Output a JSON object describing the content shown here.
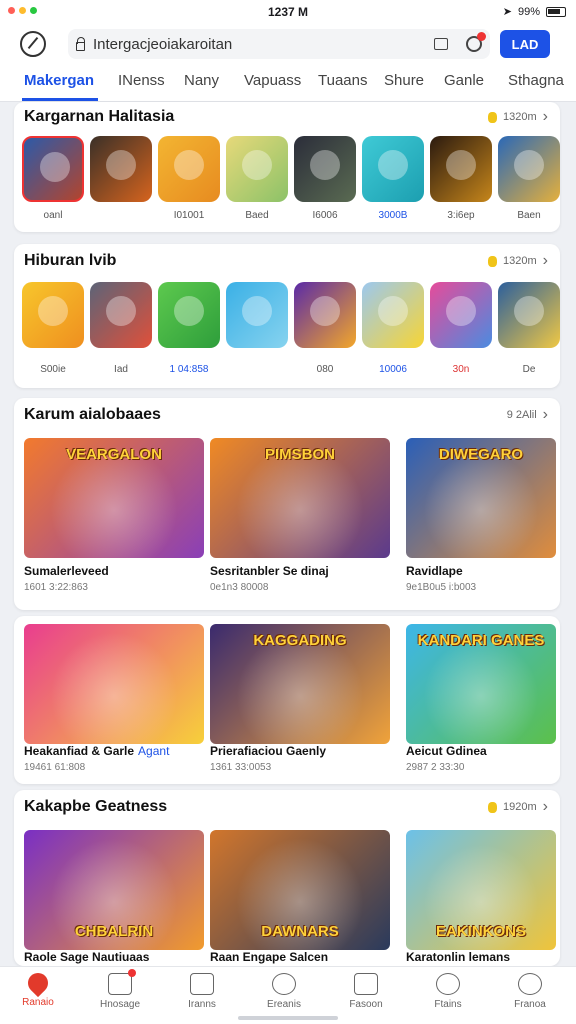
{
  "status": {
    "time": "1237 M",
    "battery": "99%"
  },
  "browser": {
    "address": "Intergacjeoiakaroitan",
    "login_label": "LAD"
  },
  "tabs": [
    "Makergan",
    "INenss",
    "Nany",
    "Vapuass",
    "Tuaans",
    "Shure",
    "Ganle",
    "Sthagna"
  ],
  "sections": [
    {
      "title": "Kargarnan Halitasia",
      "meta": "1320m",
      "apps": [
        {
          "label": "oanl",
          "c1": "#2d5aa8",
          "c2": "#b2452e",
          "label_color": "grey"
        },
        {
          "label": "",
          "c1": "#3a3028",
          "c2": "#d6641e",
          "label_color": "grey"
        },
        {
          "label": "I01001",
          "c1": "#f3b532",
          "c2": "#e78b20",
          "label_color": "grey"
        },
        {
          "label": "Baed",
          "c1": "#e7d97a",
          "c2": "#8cc268",
          "label_color": "grey"
        },
        {
          "label": "I6006",
          "c1": "#2b2d3a",
          "c2": "#5a6b52",
          "label_color": "grey"
        },
        {
          "label": "3000B",
          "c1": "#3fcad6",
          "c2": "#1c9fb0",
          "label_color": "blue"
        },
        {
          "label": "3:i6ep",
          "c1": "#2b1a0f",
          "c2": "#c6861b",
          "label_color": "grey"
        },
        {
          "label": "Baen",
          "c1": "#2a68b7",
          "c2": "#e5b03c",
          "label_color": "grey"
        }
      ]
    },
    {
      "title": "Hiburan lvib",
      "meta": "1320m",
      "apps": [
        {
          "label": "S00ie",
          "c1": "#f7c62c",
          "c2": "#ef8f1f",
          "label_color": "grey"
        },
        {
          "label": "Iad",
          "c1": "#5c6478",
          "c2": "#e0503a",
          "label_color": "grey"
        },
        {
          "label": "1 04:858",
          "c1": "#5dc94e",
          "c2": "#2e9e3b",
          "label_color": "blue"
        },
        {
          "label": "",
          "c1": "#3ab0e6",
          "c2": "#87d3ef",
          "label_color": "grey"
        },
        {
          "label": "080",
          "c1": "#5a2aa7",
          "c2": "#f3a72a",
          "label_color": "grey"
        },
        {
          "label": "10006",
          "c1": "#9cc8ef",
          "c2": "#f7d534",
          "label_color": "blue"
        },
        {
          "label": "30n",
          "c1": "#e64b9a",
          "c2": "#4b8be0",
          "label_color": "red"
        },
        {
          "label": "De",
          "c1": "#2c5f9c",
          "c2": "#f0c844",
          "label_color": "grey"
        }
      ]
    }
  ],
  "grid1": {
    "title": "Karum aialobaaes",
    "meta": "9 2Alil",
    "items": [
      {
        "title": "Sumalerleveed",
        "sub": "1601 3:22:863",
        "tag": "",
        "c1": "#f27a2d",
        "c2": "#8a3fb7",
        "banner": "VEARGALON"
      },
      {
        "title": "Sesritanbler Se dinaj",
        "sub": "0e1n3 80008",
        "tag": "",
        "c1": "#f08a24",
        "c2": "#5b3a8c",
        "banner": "PIMSBON"
      },
      {
        "title": "Ravidlape",
        "sub": "9e1B0u5 i:b003",
        "tag": "",
        "c1": "#2a5fb8",
        "c2": "#e08d3c",
        "banner": "DIWEGARO"
      }
    ]
  },
  "grid2": {
    "items": [
      {
        "title": "Heakanfiad & Garle",
        "tag": "Agant",
        "sub": "19461 61:808",
        "c1": "#e93d8f",
        "c2": "#f7d03a",
        "banner": ""
      },
      {
        "title": "Prierafiaciou Gaenly",
        "tag": "",
        "sub": "1361 33:0053",
        "c1": "#3a2a6e",
        "c2": "#f0a33a",
        "banner": "KAGGADING"
      },
      {
        "title": "Aeicut Gdinea",
        "tag": "",
        "sub": "2987 2 33:30",
        "c1": "#3db6e8",
        "c2": "#5cc04a",
        "banner": "KANDARI GANES"
      }
    ]
  },
  "grid3": {
    "title": "Kakapbe Geatness",
    "meta": "1920m",
    "items": [
      {
        "title": "Raole Sage Nautiuaas",
        "sub": "",
        "c1": "#7a2fc4",
        "c2": "#f19b2d",
        "banner": "CHBALRIN"
      },
      {
        "title": "Raan Engape Salcen",
        "sub": "",
        "c1": "#d1762c",
        "c2": "#2a3a5c",
        "banner": "DAWNARS"
      },
      {
        "title": "Karatonlin lemans",
        "sub": "",
        "c1": "#6cc1e8",
        "c2": "#f0c43a",
        "banner": "EAKINKONS"
      }
    ]
  },
  "nav": [
    {
      "label": "Ranaio",
      "icon": "home-icon",
      "active": true
    },
    {
      "label": "Hnosage",
      "icon": "message-icon",
      "active": false
    },
    {
      "label": "Iranns",
      "icon": "mail-icon",
      "active": false
    },
    {
      "label": "Ereanis",
      "icon": "game-icon",
      "active": false
    },
    {
      "label": "Fasoon",
      "icon": "calendar-icon",
      "active": false
    },
    {
      "label": "Ftains",
      "icon": "chat-icon",
      "active": false
    },
    {
      "label": "Franoa",
      "icon": "profile-icon",
      "active": false
    }
  ]
}
